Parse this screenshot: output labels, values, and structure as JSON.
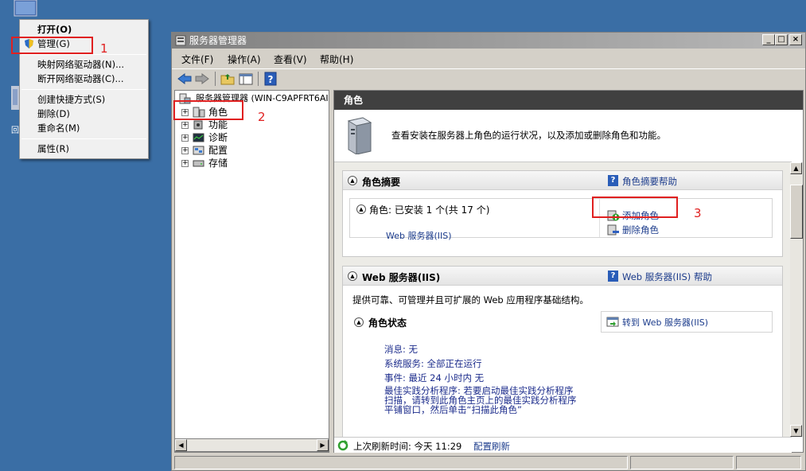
{
  "context_menu": {
    "items": [
      {
        "label": "打开(O)"
      },
      {
        "label": "管理(G)"
      },
      {
        "label": "映射网络驱动器(N)..."
      },
      {
        "label": "断开网络驱动器(C)..."
      },
      {
        "label": "创建快捷方式(S)"
      },
      {
        "label": "删除(D)"
      },
      {
        "label": "重命名(M)"
      },
      {
        "label": "属性(R)"
      }
    ]
  },
  "annotations": {
    "one": "1",
    "two": "2",
    "three": "3"
  },
  "window": {
    "title": "服务器管理器",
    "menu": [
      "文件(F)",
      "操作(A)",
      "查看(V)",
      "帮助(H)"
    ]
  },
  "tree": {
    "root": "服务器管理器 (WIN-C9APFRT6AI",
    "items": [
      "角色",
      "功能",
      "诊断",
      "配置",
      "存储"
    ]
  },
  "pane": {
    "header": "角色",
    "intro": "查看安装在服务器上角色的运行状况，以及添加或删除角色和功能。",
    "summary": {
      "title": "角色摘要",
      "help": "角色摘要帮助",
      "roles_label": "角色: 已安装 1 个(共 17 个)",
      "role_link": "Web 服务器(IIS)",
      "add": "添加角色",
      "remove": "删除角色"
    },
    "web": {
      "title": "Web 服务器(IIS)",
      "help": "Web 服务器(IIS) 帮助",
      "desc": "提供可靠、可管理并且可扩展的 Web 应用程序基础结构。",
      "status_title": "角色状态",
      "goto": "转到 Web 服务器(IIS)",
      "msg": "消息: 无",
      "services": "系统服务: 全部正在运行",
      "events": "事件: 最近 24 小时内 无",
      "bpa1": "最佳实践分析程序: 若要启动最佳实践分析程序",
      "bpa2": "扫描，请转到此角色主页上的最佳实践分析程序",
      "bpa3": "平铺窗口，然后单击“扫描此角色”"
    },
    "refresh": {
      "label": "上次刷新时间: 今天 11:29",
      "link": "配置刷新"
    }
  }
}
